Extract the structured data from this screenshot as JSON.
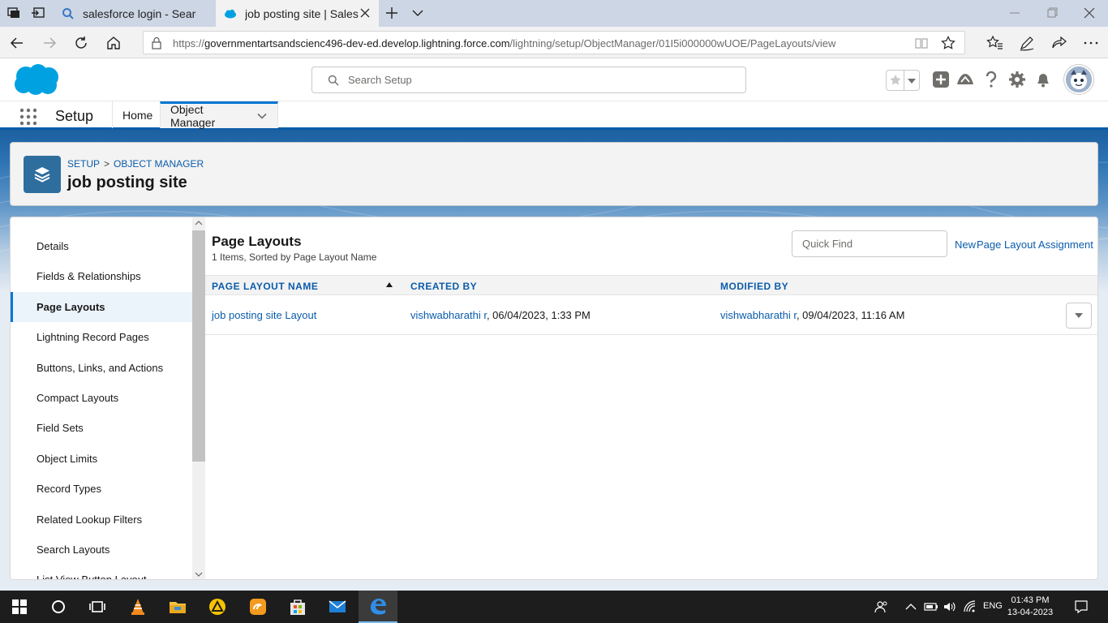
{
  "browser": {
    "tabs": [
      {
        "label": "salesforce login - Search"
      },
      {
        "label": "job posting site | Salesforce"
      }
    ],
    "url": {
      "prefix": "https://",
      "domain": "governmentartsandscienc496-dev-ed.develop.lightning.force.com",
      "path": "/lightning/setup/ObjectManager/01I5i000000wUOE/PageLayouts/view"
    }
  },
  "header": {
    "search_placeholder": "Search Setup"
  },
  "setup_nav": {
    "app_name": "Setup",
    "tabs": [
      {
        "label": "Home"
      },
      {
        "label": "Object Manager"
      }
    ]
  },
  "object": {
    "breadcrumb": [
      "SETUP",
      ">",
      "OBJECT MANAGER"
    ],
    "title": "job posting site"
  },
  "sidebar": {
    "items": [
      {
        "label": "Details"
      },
      {
        "label": "Fields & Relationships"
      },
      {
        "label": "Page Layouts"
      },
      {
        "label": "Lightning Record Pages"
      },
      {
        "label": "Buttons, Links, and Actions"
      },
      {
        "label": "Compact Layouts"
      },
      {
        "label": "Field Sets"
      },
      {
        "label": "Object Limits"
      },
      {
        "label": "Record Types"
      },
      {
        "label": "Related Lookup Filters"
      },
      {
        "label": "Search Layouts"
      },
      {
        "label": "List View Button Layout"
      }
    ],
    "active_index": 2
  },
  "content": {
    "title": "Page Layouts",
    "subtitle": "1 Items, Sorted by Page Layout Name",
    "quick_find_placeholder": "Quick Find",
    "new_label": "New",
    "assignment_label": "Page Layout Assignment",
    "columns": [
      "PAGE LAYOUT NAME",
      "CREATED BY",
      "MODIFIED BY"
    ],
    "rows": [
      {
        "name": "job posting site Layout",
        "created_user": "vishwabharathi r",
        "created_date": ", 06/04/2023, 1:33 PM",
        "modified_user": "vishwabharathi r",
        "modified_date": ", 09/04/2023, 11:16 AM"
      }
    ]
  },
  "taskbar": {
    "language": "ENG",
    "time": "01:43 PM",
    "date": "13-04-2023"
  },
  "colors": {
    "brand_blue": "#0176d3",
    "link_blue": "#0b5cab",
    "salesforce_cloud": "#00a1e0"
  }
}
